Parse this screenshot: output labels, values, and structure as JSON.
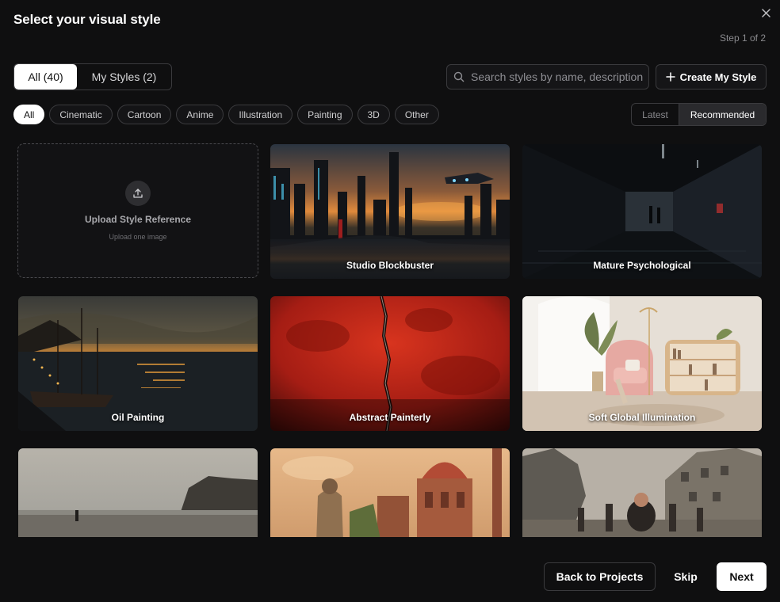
{
  "dialog": {
    "title": "Select your visual style",
    "step": "Step 1 of 2"
  },
  "tabs": [
    {
      "label": "All (40)",
      "active": true
    },
    {
      "label": "My Styles (2)",
      "active": false
    }
  ],
  "search": {
    "placeholder": "Search styles by name, description"
  },
  "create_button": {
    "label": "Create My Style",
    "icon": "plus-icon"
  },
  "categories": [
    "All",
    "Cinematic",
    "Cartoon",
    "Anime",
    "Illustration",
    "Painting",
    "3D",
    "Other"
  ],
  "selected_category": "All",
  "sort": {
    "options": [
      "Latest",
      "Recommended"
    ],
    "selected": "Recommended"
  },
  "upload_card": {
    "title": "Upload Style Reference",
    "subtitle": "Upload one image",
    "icon": "upload-icon"
  },
  "styles": [
    {
      "name": "Studio Blockbuster"
    },
    {
      "name": "Mature Psychological"
    },
    {
      "name": "Oil Painting"
    },
    {
      "name": "Abstract Painterly"
    },
    {
      "name": "Soft Global Illumination"
    },
    {
      "name": ""
    },
    {
      "name": ""
    },
    {
      "name": ""
    }
  ],
  "footer": {
    "back_label": "Back to Projects",
    "skip_label": "Skip",
    "next_label": "Next"
  },
  "colors": {
    "background": "#0f0f10",
    "border": "#3a3a3d",
    "primary_button": "#ffffff"
  }
}
